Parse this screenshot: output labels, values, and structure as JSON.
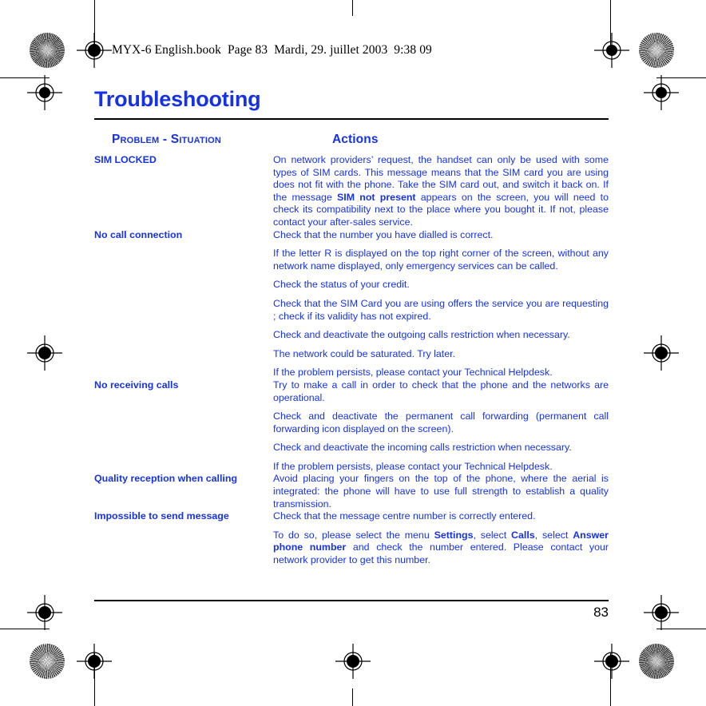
{
  "page": {
    "slug": "MYX-6 English.book  Page 83  Mardi, 29. juillet 2003  9:38 09",
    "title": "Troubleshooting",
    "page_number": "83",
    "accent_color": "#1632E6",
    "rule_color": "#000000"
  },
  "table": {
    "headers": {
      "problem": "Problem - Situation",
      "actions": "Actions"
    },
    "rows": [
      {
        "problem": "SIM LOCKED",
        "actions": [
          {
            "parts": [
              {
                "text": "On network providers’ request, the handset can only be used with some types of SIM cards. This message means that the SIM card you are using does not fit with the phone. Take the SIM card out, and switch it back on. If the message ",
                "bold": false
              },
              {
                "text": "SIM not present",
                "bold": true
              },
              {
                "text": " appears on the screen, you will need to check its compatibility next to the place where you bought it. If not, please contact your after-sales service.",
                "bold": false
              }
            ]
          }
        ]
      },
      {
        "problem": "No call connection",
        "actions": [
          {
            "parts": [
              {
                "text": "Check that the number you have dialled is correct.",
                "bold": false
              }
            ]
          },
          {
            "parts": [
              {
                "text": "If the letter R is displayed on the top right corner of the screen, without any network name displayed, only emergency services can be called.",
                "bold": false
              }
            ]
          },
          {
            "parts": [
              {
                "text": "Check the status of your credit.",
                "bold": false
              }
            ]
          },
          {
            "parts": [
              {
                "text": "Check that the SIM Card you are using offers the service you are requesting ; check if its validity has not expired.",
                "bold": false
              }
            ]
          },
          {
            "parts": [
              {
                "text": "Check and deactivate the outgoing calls restriction when necessary.",
                "bold": false
              }
            ]
          },
          {
            "parts": [
              {
                "text": "The network could be saturated. Try later.",
                "bold": false
              }
            ]
          },
          {
            "parts": [
              {
                "text": "If the problem persists, please contact your Technical Helpdesk.",
                "bold": false
              }
            ]
          }
        ]
      },
      {
        "problem": "No receiving calls",
        "actions": [
          {
            "parts": [
              {
                "text": "Try to make a call in order to check that the phone and the networks are operational.",
                "bold": false
              }
            ]
          },
          {
            "parts": [
              {
                "text": "Check and deactivate the permanent call forwarding (permanent call forwarding icon displayed on the screen).",
                "bold": false
              }
            ]
          },
          {
            "parts": [
              {
                "text": "Check and deactivate the incoming calls restriction when necessary.",
                "bold": false
              }
            ]
          },
          {
            "parts": [
              {
                "text": "If the problem persists, please contact your Technical Helpdesk.",
                "bold": false
              }
            ]
          }
        ]
      },
      {
        "problem": "Quality reception when calling",
        "actions": [
          {
            "parts": [
              {
                "text": "Avoid placing your fingers on the top of the phone, where the aerial is integrated: the phone will have to use full strength to establish a quality transmission.",
                "bold": false
              }
            ]
          }
        ]
      },
      {
        "problem": "Impossible to send message",
        "actions": [
          {
            "parts": [
              {
                "text": "Check that the message centre number is correctly entered.",
                "bold": false
              }
            ]
          },
          {
            "parts": [
              {
                "text": "To do so, please select the menu ",
                "bold": false
              },
              {
                "text": "Settings",
                "bold": true
              },
              {
                "text": ", select ",
                "bold": false
              },
              {
                "text": "Calls",
                "bold": true
              },
              {
                "text": ", select ",
                "bold": false
              },
              {
                "text": "Answer phone number",
                "bold": true
              },
              {
                "text": " and check the number entered. Please contact your network provider to get this number.",
                "bold": false
              }
            ]
          }
        ]
      }
    ]
  }
}
